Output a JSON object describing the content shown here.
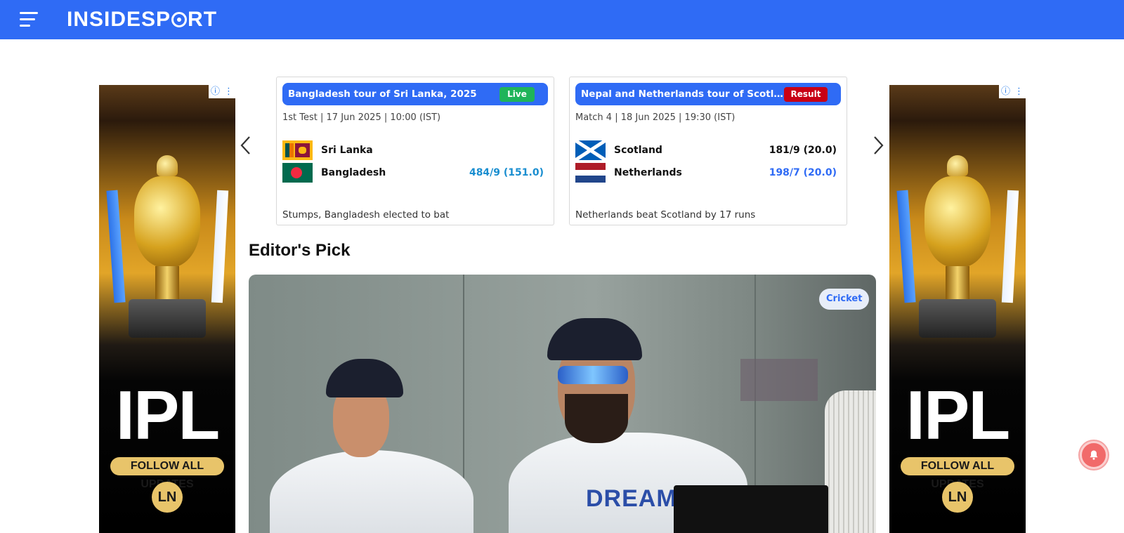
{
  "header": {
    "logo_text": "INSIDESPORT",
    "brand_color": "#2f6bf5"
  },
  "ads": {
    "left": {
      "headline": "IPL",
      "cta": "FOLLOW ALL UPDATES",
      "logo": "LN",
      "info_icon": "ⓘ",
      "menu_icon": "⋮"
    },
    "right": {
      "headline": "IPL",
      "cta": "FOLLOW ALL UPDATES",
      "logo": "LN",
      "info_icon": "ⓘ",
      "menu_icon": "⋮"
    }
  },
  "score_cards": [
    {
      "series": "Bangladesh tour of Sri Lanka, 2025",
      "status": "Live",
      "status_color": "#1fb45a",
      "meta": "1st Test | 17 Jun 2025 | 10:00 (IST)",
      "teams": [
        {
          "name": "Sri Lanka",
          "score": "",
          "flag": "sri-lanka-flag"
        },
        {
          "name": "Bangladesh",
          "score": "484/9 (151.0)",
          "score_color": "#1a8ed0",
          "flag": "bangladesh-flag"
        }
      ],
      "result": "Stumps, Bangladesh elected to bat"
    },
    {
      "series": "Nepal and Netherlands tour of Scotland,...",
      "status": "Result",
      "status_color": "#c80015",
      "meta": "Match 4 | 18 Jun 2025 | 19:30 (IST)",
      "teams": [
        {
          "name": "Scotland",
          "score": "181/9 (20.0)",
          "score_color": "#111111",
          "flag": "scotland-flag"
        },
        {
          "name": "Netherlands",
          "score": "198/7 (20.0)",
          "score_color": "#2f6bf5",
          "flag": "netherlands-flag"
        }
      ],
      "result": "Netherlands beat Scotland by 17 runs"
    }
  ],
  "carousel": {
    "prev_icon": "chevron-left-icon",
    "next_icon": "chevron-right-icon"
  },
  "editors_pick": {
    "title": "Editor's Pick",
    "category": "Cricket",
    "jersey_text": "DREAM"
  },
  "notification": {
    "icon": "bell-icon",
    "color": "#f16a6a"
  }
}
